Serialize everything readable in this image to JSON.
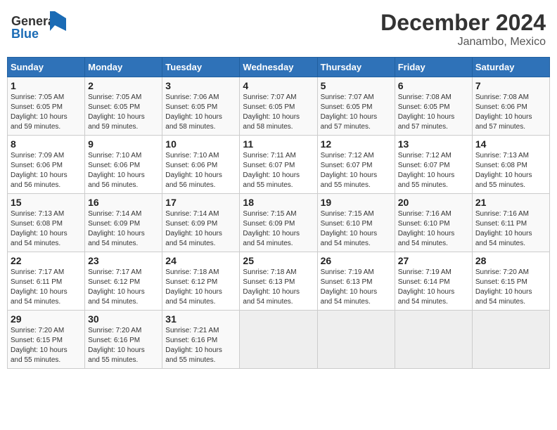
{
  "header": {
    "logo_line1": "General",
    "logo_line2": "Blue",
    "title": "December 2024",
    "subtitle": "Janambo, Mexico"
  },
  "calendar": {
    "columns": [
      "Sunday",
      "Monday",
      "Tuesday",
      "Wednesday",
      "Thursday",
      "Friday",
      "Saturday"
    ],
    "weeks": [
      [
        {
          "day": "",
          "info": ""
        },
        {
          "day": "2",
          "info": "Sunrise: 7:05 AM\nSunset: 6:05 PM\nDaylight: 10 hours\nand 59 minutes."
        },
        {
          "day": "3",
          "info": "Sunrise: 7:06 AM\nSunset: 6:05 PM\nDaylight: 10 hours\nand 58 minutes."
        },
        {
          "day": "4",
          "info": "Sunrise: 7:07 AM\nSunset: 6:05 PM\nDaylight: 10 hours\nand 58 minutes."
        },
        {
          "day": "5",
          "info": "Sunrise: 7:07 AM\nSunset: 6:05 PM\nDaylight: 10 hours\nand 57 minutes."
        },
        {
          "day": "6",
          "info": "Sunrise: 7:08 AM\nSunset: 6:05 PM\nDaylight: 10 hours\nand 57 minutes."
        },
        {
          "day": "7",
          "info": "Sunrise: 7:08 AM\nSunset: 6:06 PM\nDaylight: 10 hours\nand 57 minutes."
        }
      ],
      [
        {
          "day": "1",
          "info": "Sunrise: 7:05 AM\nSunset: 6:05 PM\nDaylight: 10 hours\nand 59 minutes."
        },
        {
          "day": "",
          "info": ""
        },
        {
          "day": "",
          "info": ""
        },
        {
          "day": "",
          "info": ""
        },
        {
          "day": "",
          "info": ""
        },
        {
          "day": "",
          "info": ""
        },
        {
          "day": "",
          "info": ""
        }
      ],
      [
        {
          "day": "8",
          "info": "Sunrise: 7:09 AM\nSunset: 6:06 PM\nDaylight: 10 hours\nand 56 minutes."
        },
        {
          "day": "9",
          "info": "Sunrise: 7:10 AM\nSunset: 6:06 PM\nDaylight: 10 hours\nand 56 minutes."
        },
        {
          "day": "10",
          "info": "Sunrise: 7:10 AM\nSunset: 6:06 PM\nDaylight: 10 hours\nand 56 minutes."
        },
        {
          "day": "11",
          "info": "Sunrise: 7:11 AM\nSunset: 6:07 PM\nDaylight: 10 hours\nand 55 minutes."
        },
        {
          "day": "12",
          "info": "Sunrise: 7:12 AM\nSunset: 6:07 PM\nDaylight: 10 hours\nand 55 minutes."
        },
        {
          "day": "13",
          "info": "Sunrise: 7:12 AM\nSunset: 6:07 PM\nDaylight: 10 hours\nand 55 minutes."
        },
        {
          "day": "14",
          "info": "Sunrise: 7:13 AM\nSunset: 6:08 PM\nDaylight: 10 hours\nand 55 minutes."
        }
      ],
      [
        {
          "day": "15",
          "info": "Sunrise: 7:13 AM\nSunset: 6:08 PM\nDaylight: 10 hours\nand 54 minutes."
        },
        {
          "day": "16",
          "info": "Sunrise: 7:14 AM\nSunset: 6:09 PM\nDaylight: 10 hours\nand 54 minutes."
        },
        {
          "day": "17",
          "info": "Sunrise: 7:14 AM\nSunset: 6:09 PM\nDaylight: 10 hours\nand 54 minutes."
        },
        {
          "day": "18",
          "info": "Sunrise: 7:15 AM\nSunset: 6:09 PM\nDaylight: 10 hours\nand 54 minutes."
        },
        {
          "day": "19",
          "info": "Sunrise: 7:15 AM\nSunset: 6:10 PM\nDaylight: 10 hours\nand 54 minutes."
        },
        {
          "day": "20",
          "info": "Sunrise: 7:16 AM\nSunset: 6:10 PM\nDaylight: 10 hours\nand 54 minutes."
        },
        {
          "day": "21",
          "info": "Sunrise: 7:16 AM\nSunset: 6:11 PM\nDaylight: 10 hours\nand 54 minutes."
        }
      ],
      [
        {
          "day": "22",
          "info": "Sunrise: 7:17 AM\nSunset: 6:11 PM\nDaylight: 10 hours\nand 54 minutes."
        },
        {
          "day": "23",
          "info": "Sunrise: 7:17 AM\nSunset: 6:12 PM\nDaylight: 10 hours\nand 54 minutes."
        },
        {
          "day": "24",
          "info": "Sunrise: 7:18 AM\nSunset: 6:12 PM\nDaylight: 10 hours\nand 54 minutes."
        },
        {
          "day": "25",
          "info": "Sunrise: 7:18 AM\nSunset: 6:13 PM\nDaylight: 10 hours\nand 54 minutes."
        },
        {
          "day": "26",
          "info": "Sunrise: 7:19 AM\nSunset: 6:13 PM\nDaylight: 10 hours\nand 54 minutes."
        },
        {
          "day": "27",
          "info": "Sunrise: 7:19 AM\nSunset: 6:14 PM\nDaylight: 10 hours\nand 54 minutes."
        },
        {
          "day": "28",
          "info": "Sunrise: 7:20 AM\nSunset: 6:15 PM\nDaylight: 10 hours\nand 54 minutes."
        }
      ],
      [
        {
          "day": "29",
          "info": "Sunrise: 7:20 AM\nSunset: 6:15 PM\nDaylight: 10 hours\nand 55 minutes."
        },
        {
          "day": "30",
          "info": "Sunrise: 7:20 AM\nSunset: 6:16 PM\nDaylight: 10 hours\nand 55 minutes."
        },
        {
          "day": "31",
          "info": "Sunrise: 7:21 AM\nSunset: 6:16 PM\nDaylight: 10 hours\nand 55 minutes."
        },
        {
          "day": "",
          "info": ""
        },
        {
          "day": "",
          "info": ""
        },
        {
          "day": "",
          "info": ""
        },
        {
          "day": "",
          "info": ""
        }
      ]
    ]
  }
}
